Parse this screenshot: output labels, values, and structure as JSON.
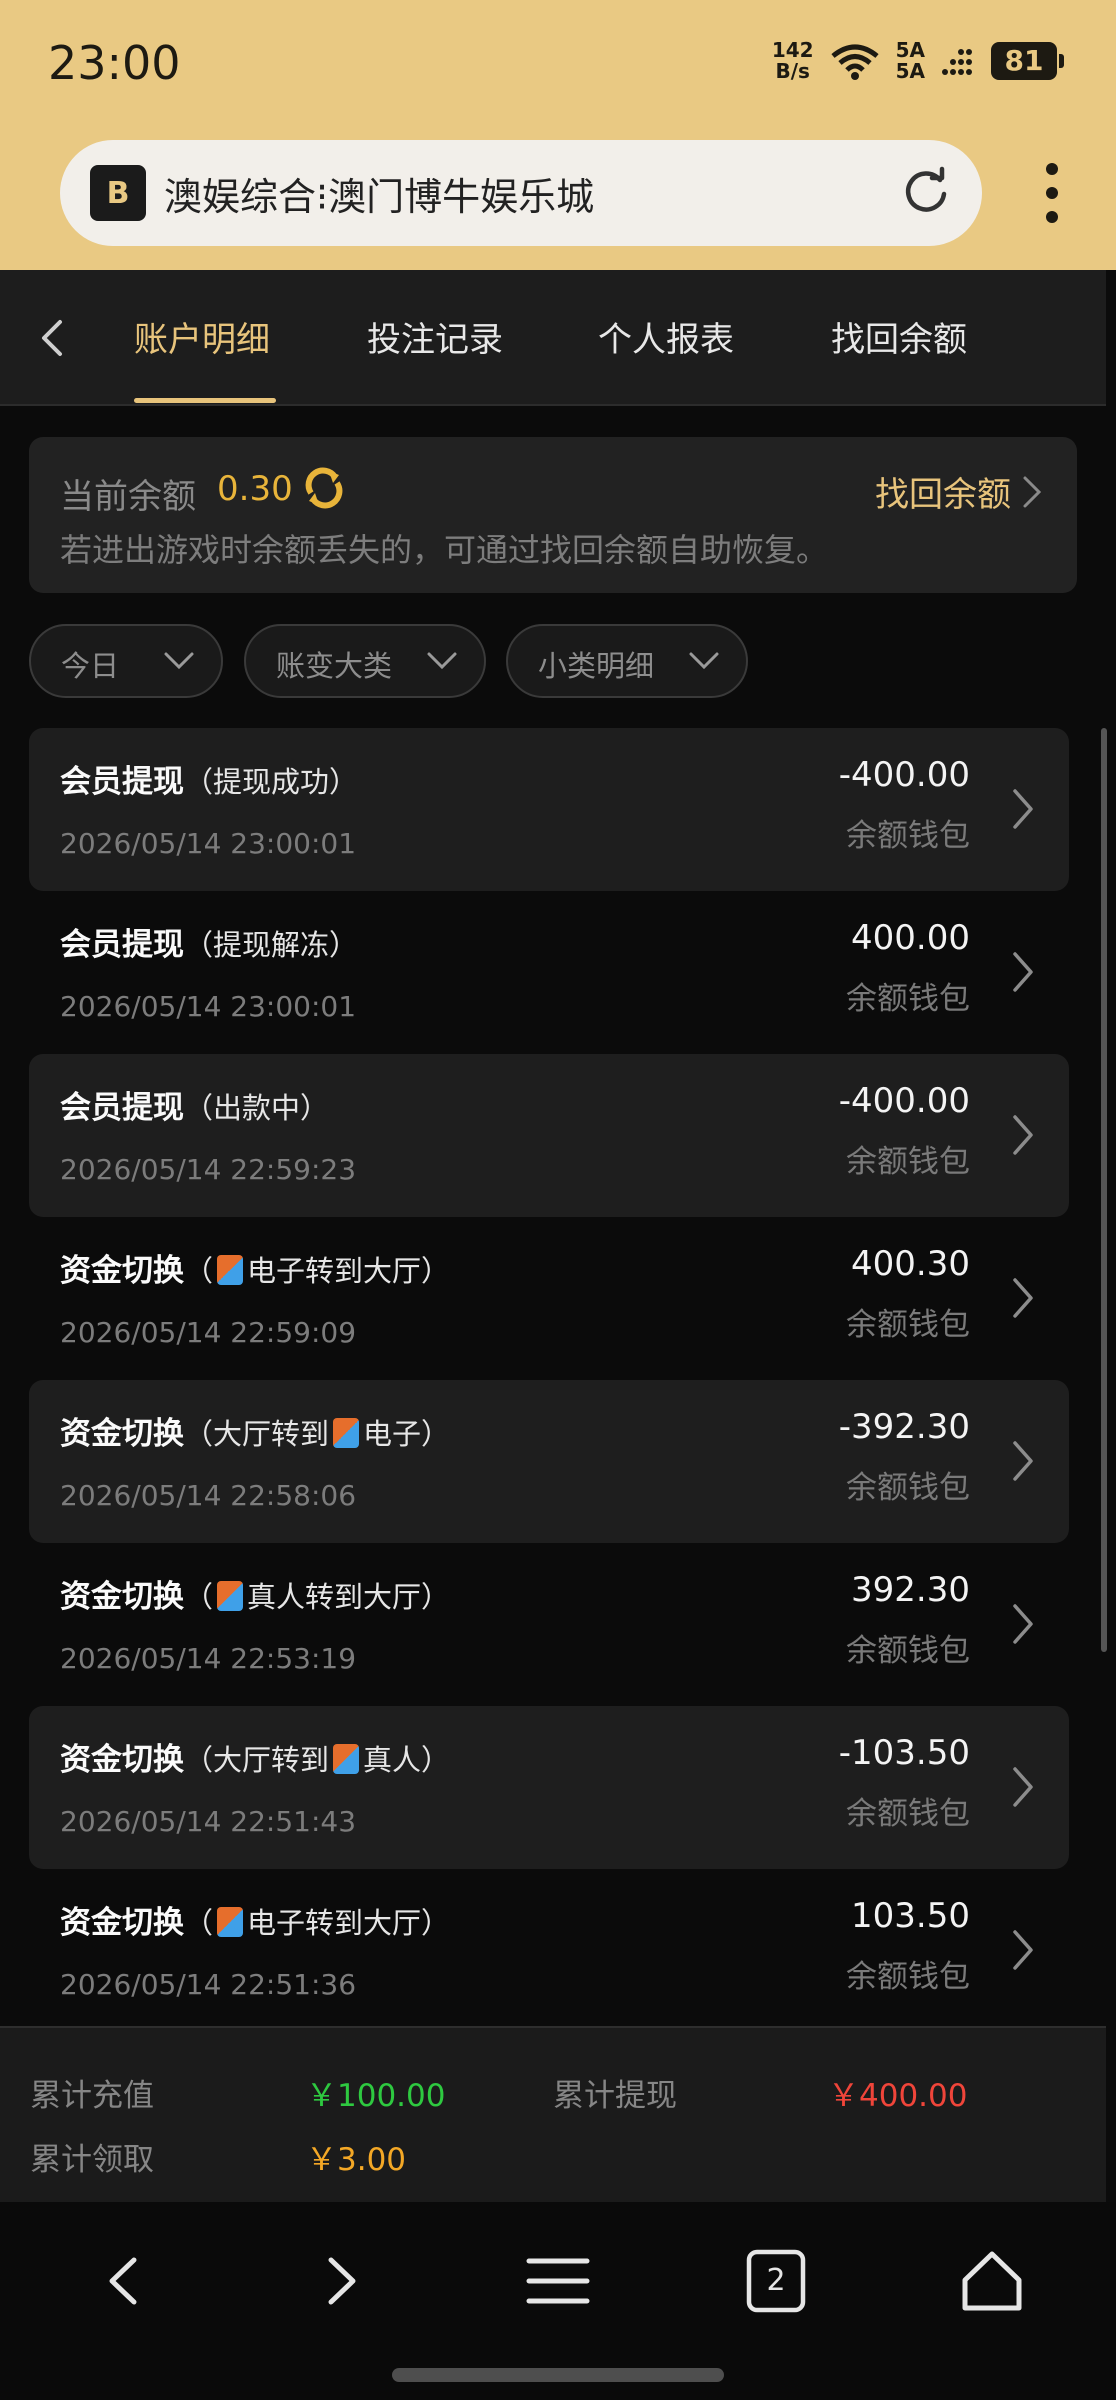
{
  "status": {
    "time": "23:00",
    "speed_value": "142",
    "speed_unit": "B/s",
    "signal_1": "5A",
    "signal_2": "5A",
    "battery": "81"
  },
  "browser": {
    "site_title": "澳娱综合⁝澳门博牛娱乐城",
    "logo_letter": "B"
  },
  "tabs": [
    {
      "label": "账户明细",
      "active": true
    },
    {
      "label": "投注记录",
      "active": false
    },
    {
      "label": "个人报表",
      "active": false
    },
    {
      "label": "找回余额",
      "active": false
    }
  ],
  "balance": {
    "label": "当前余额",
    "value": "0.30",
    "recover_label": "找回余额",
    "note": "若进出游戏时余额丢失的，可通过找回余额自助恢复。"
  },
  "filters": [
    {
      "label": "今日"
    },
    {
      "label": "账变大类"
    },
    {
      "label": "小类明细"
    }
  ],
  "records": [
    {
      "title": "会员提现",
      "pre": "（提现成功）",
      "badge": false,
      "post": "",
      "time": "2026/05/14 23:00:01",
      "amount": "-400.00",
      "wallet": "余额钱包"
    },
    {
      "title": "会员提现",
      "pre": "（提现解冻）",
      "badge": false,
      "post": "",
      "time": "2026/05/14 23:00:01",
      "amount": "400.00",
      "wallet": "余额钱包"
    },
    {
      "title": "会员提现",
      "pre": "（出款中）",
      "badge": false,
      "post": "",
      "time": "2026/05/14 22:59:23",
      "amount": "-400.00",
      "wallet": "余额钱包"
    },
    {
      "title": "资金切换",
      "pre": "（",
      "badge": true,
      "post": "电子转到大厅）",
      "time": "2026/05/14 22:59:09",
      "amount": "400.30",
      "wallet": "余额钱包"
    },
    {
      "title": "资金切换",
      "pre": "（大厅转到",
      "badge": true,
      "post": "电子）",
      "time": "2026/05/14 22:58:06",
      "amount": "-392.30",
      "wallet": "余额钱包"
    },
    {
      "title": "资金切换",
      "pre": "（",
      "badge": true,
      "post": "真人转到大厅）",
      "time": "2026/05/14 22:53:19",
      "amount": "392.30",
      "wallet": "余额钱包"
    },
    {
      "title": "资金切换",
      "pre": "（大厅转到",
      "badge": true,
      "post": "真人）",
      "time": "2026/05/14 22:51:43",
      "amount": "-103.50",
      "wallet": "余额钱包"
    },
    {
      "title": "资金切换",
      "pre": "（",
      "badge": true,
      "post": "电子转到大厅）",
      "time": "2026/05/14 22:51:36",
      "amount": "103.50",
      "wallet": "余额钱包"
    }
  ],
  "summary": {
    "recharge_label": "累计充值",
    "recharge_value": "￥100.00",
    "withdraw_label": "累计提现",
    "withdraw_value": "￥400.00",
    "claim_label": "累计领取",
    "claim_value": "￥3.00"
  },
  "nav": {
    "tab_count": "2"
  },
  "colors": {
    "accent": "#e8c47c",
    "balance": "#e8b43a",
    "green": "#2ec940",
    "red": "#f0453a",
    "orange": "#f4a826"
  }
}
